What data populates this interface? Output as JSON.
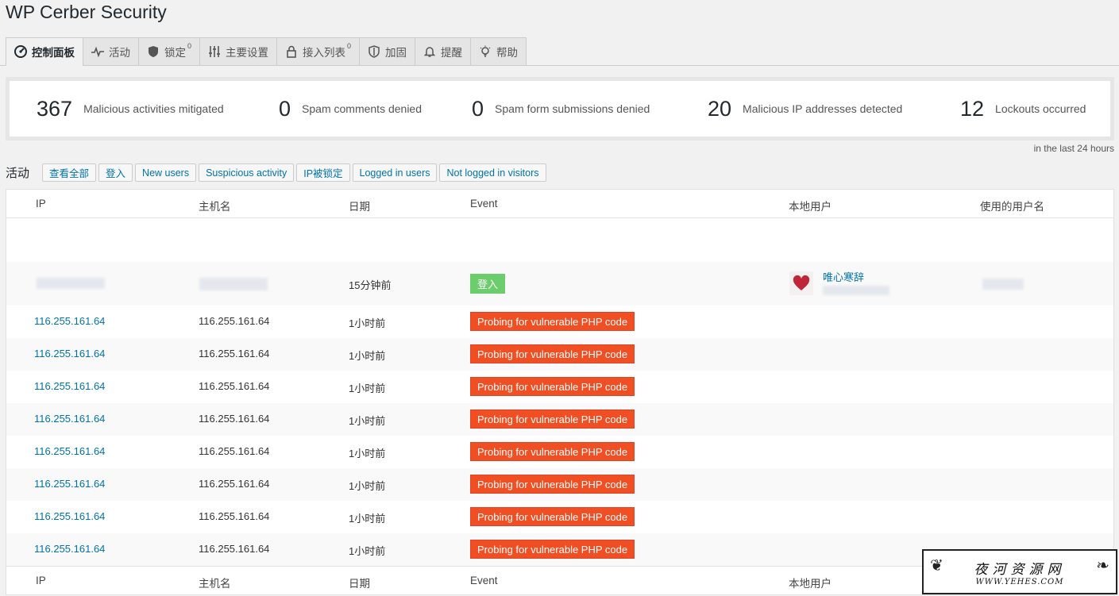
{
  "page": {
    "title": "WP Cerber Security"
  },
  "tabs": [
    {
      "label": "控制面板",
      "icon": "dashboard-icon",
      "active": true,
      "count": ""
    },
    {
      "label": "活动",
      "icon": "activity-icon",
      "active": false,
      "count": ""
    },
    {
      "label": "锁定",
      "icon": "shield-icon",
      "active": false,
      "count": "0"
    },
    {
      "label": "主要设置",
      "icon": "sliders-icon",
      "active": false,
      "count": ""
    },
    {
      "label": "接入列表",
      "icon": "lock-icon",
      "active": false,
      "count": "0"
    },
    {
      "label": "加固",
      "icon": "shield-outline-icon",
      "active": false,
      "count": ""
    },
    {
      "label": "提醒",
      "icon": "bell-icon",
      "active": false,
      "count": ""
    },
    {
      "label": "帮助",
      "icon": "lightbulb-icon",
      "active": false,
      "count": ""
    }
  ],
  "stats": [
    {
      "value": "367",
      "label": "Malicious activities mitigated"
    },
    {
      "value": "0",
      "label": "Spam comments denied"
    },
    {
      "value": "0",
      "label": "Spam form submissions denied"
    },
    {
      "value": "20",
      "label": "Malicious IP addresses detected"
    },
    {
      "value": "12",
      "label": "Lockouts occurred"
    }
  ],
  "stats_note": "in the last 24 hours",
  "activity": {
    "title": "活动",
    "filters": [
      "查看全部",
      "登入",
      "New users",
      "Suspicious activity",
      "IP被锁定",
      "Logged in users",
      "Not logged in visitors"
    ]
  },
  "table": {
    "headers": [
      "IP",
      "主机名",
      "日期",
      "Event",
      "本地用户",
      "使用的用户名"
    ],
    "login_row": {
      "date": "15分钟前",
      "event": "登入",
      "user": "唯心寒辞"
    },
    "rows": [
      {
        "ip": "116.255.161.64",
        "host": "116.255.161.64",
        "date": "1小时前",
        "event": "Probing for vulnerable PHP code"
      },
      {
        "ip": "116.255.161.64",
        "host": "116.255.161.64",
        "date": "1小时前",
        "event": "Probing for vulnerable PHP code"
      },
      {
        "ip": "116.255.161.64",
        "host": "116.255.161.64",
        "date": "1小时前",
        "event": "Probing for vulnerable PHP code"
      },
      {
        "ip": "116.255.161.64",
        "host": "116.255.161.64",
        "date": "1小时前",
        "event": "Probing for vulnerable PHP code"
      },
      {
        "ip": "116.255.161.64",
        "host": "116.255.161.64",
        "date": "1小时前",
        "event": "Probing for vulnerable PHP code"
      },
      {
        "ip": "116.255.161.64",
        "host": "116.255.161.64",
        "date": "1小时前",
        "event": "Probing for vulnerable PHP code"
      },
      {
        "ip": "116.255.161.64",
        "host": "116.255.161.64",
        "date": "1小时前",
        "event": "Probing for vulnerable PHP code"
      },
      {
        "ip": "116.255.161.64",
        "host": "116.255.161.64",
        "date": "1小时前",
        "event": "Probing for vulnerable PHP code"
      }
    ],
    "footer_headers": [
      "IP",
      "主机名",
      "日期",
      "Event",
      "本地用户"
    ]
  },
  "watermark": {
    "cn": "夜河资源网",
    "en": "WWW.YEHES.COM"
  },
  "colors": {
    "link": "#0073aa",
    "danger": "#f04e23",
    "success": "#6ccd6c"
  }
}
